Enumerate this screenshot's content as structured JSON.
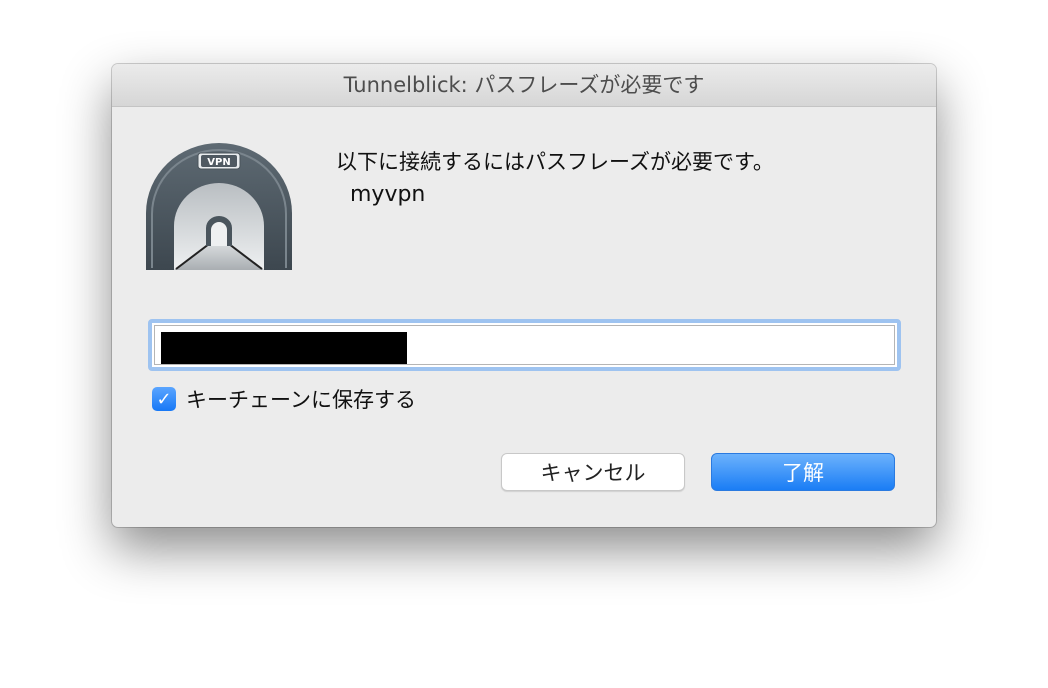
{
  "window": {
    "title": "Tunnelblick: パスフレーズが必要です"
  },
  "icon": {
    "name": "tunnelblick-icon",
    "badge": "VPN"
  },
  "message": {
    "prompt": "以下に接続するにはパスフレーズが必要です。",
    "connection_name": "myvpn"
  },
  "password_field": {
    "value": ""
  },
  "keychain": {
    "checked": true,
    "label": "キーチェーンに保存する"
  },
  "buttons": {
    "cancel_label": "キャンセル",
    "ok_label": "了解"
  },
  "colors": {
    "accent": "#1a7df5",
    "focus_ring": "#9ec3f0",
    "window_bg": "#ececec"
  }
}
